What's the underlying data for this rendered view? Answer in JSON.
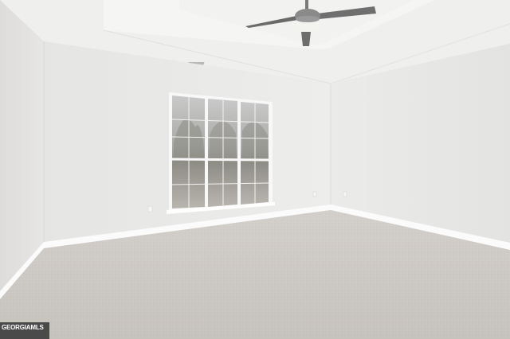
{
  "scene": {
    "description_colors": {
      "wall_left": "#e6e6e4",
      "wall_back": "#ececea",
      "wall_right": "#e8e8e6",
      "ceiling": "#f1f1ef",
      "tray_ceiling": "#f4f4f2",
      "carpet": "#cdc9c3",
      "baseboard": "#fafafa",
      "window_frame": "#f7f7f7",
      "fan_body": "#6d6d6d"
    }
  },
  "watermark": {
    "brand": "GEORGIAMLS",
    "sub": ""
  }
}
